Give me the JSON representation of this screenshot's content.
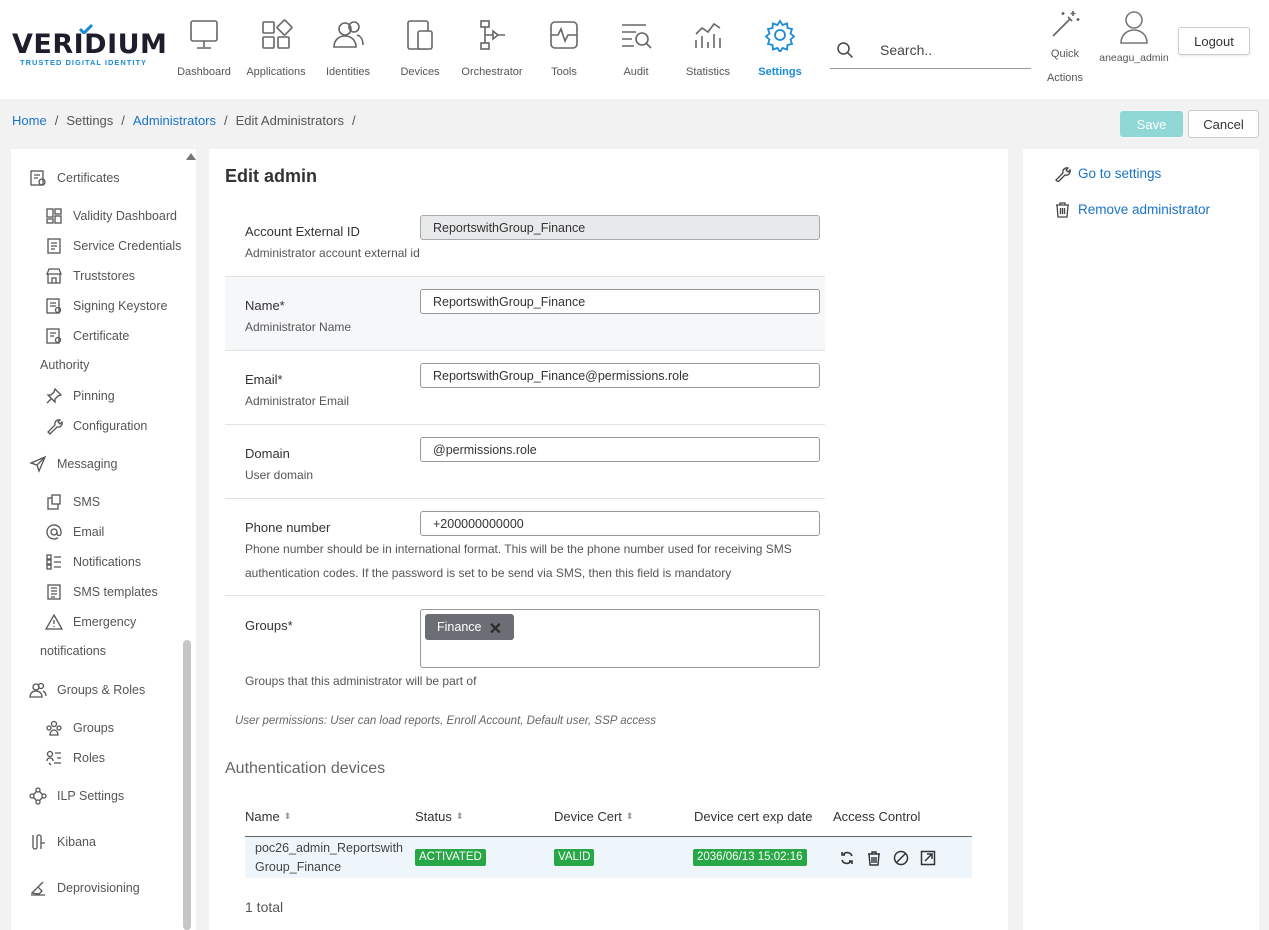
{
  "brand": {
    "name": "VERIDIUM",
    "tagline": "TRUSTED DIGITAL IDENTITY",
    "accent": "#1a8bd6"
  },
  "nav": [
    {
      "label": "Dashboard",
      "icon": "monitor-icon",
      "active": false
    },
    {
      "label": "Applications",
      "icon": "apps-icon",
      "active": false
    },
    {
      "label": "Identities",
      "icon": "identities-icon",
      "active": false
    },
    {
      "label": "Devices",
      "icon": "devices-icon",
      "active": false
    },
    {
      "label": "Orchestrator",
      "icon": "orchestrator-icon",
      "active": false
    },
    {
      "label": "Tools",
      "icon": "tools-icon",
      "active": false
    },
    {
      "label": "Audit",
      "icon": "audit-icon",
      "active": false
    },
    {
      "label": "Statistics",
      "icon": "statistics-icon",
      "active": false
    },
    {
      "label": "Settings",
      "icon": "gear-icon",
      "active": true
    }
  ],
  "search": {
    "placeholder": "Search.."
  },
  "quick_actions": {
    "label_line1": "Quick",
    "label_line2": "Actions"
  },
  "user": {
    "name": "aneagu_admin"
  },
  "logout_label": "Logout",
  "breadcrumb": {
    "home": "Home",
    "settings": "Settings",
    "administrators": "Administrators",
    "current": "Edit Administrators",
    "sep": "/"
  },
  "actions": {
    "save": "Save",
    "cancel": "Cancel"
  },
  "sidebar": {
    "certificates": "Certificates",
    "validity_dashboard": "Validity Dashboard",
    "service_credentials": "Service Credentials",
    "truststores": "Truststores",
    "signing_keystore": "Signing Keystore",
    "certificate": "Certificate",
    "authority": "Authority",
    "pinning": "Pinning",
    "configuration": "Configuration",
    "messaging": "Messaging",
    "sms": "SMS",
    "email": "Email",
    "notifications": "Notifications",
    "sms_templates": "SMS templates",
    "emergency": "Emergency",
    "emergency_notifications": "notifications",
    "groups_roles": "Groups & Roles",
    "groups": "Groups",
    "roles": "Roles",
    "ilp_settings": "ILP Settings",
    "kibana": "Kibana",
    "deprovisioning": "Deprovisioning"
  },
  "form": {
    "title": "Edit admin",
    "external_id": {
      "label": "Account External ID",
      "help": "Administrator account external id",
      "value": "ReportswithGroup_Finance"
    },
    "name": {
      "label": "Name*",
      "help": "Administrator Name",
      "value": "ReportswithGroup_Finance"
    },
    "email": {
      "label": "Email*",
      "help": "Administrator Email",
      "value": "ReportswithGroup_Finance@permissions.role"
    },
    "domain": {
      "label": "Domain",
      "help": "User domain",
      "value": "@permissions.role"
    },
    "phone": {
      "label": "Phone number",
      "help_line1": "Phone number should be in international format. This will be the phone number used for receiving SMS",
      "help_line2": "authentication codes. If the password is set to be send via SMS, then this field is mandatory",
      "value": "+200000000000"
    },
    "groups": {
      "label": "Groups*",
      "help": "Groups that this administrator will be part of",
      "chips": [
        "Finance"
      ]
    },
    "permissions": "User permissions: User can load reports, Enroll Account, Default user, SSP access"
  },
  "devices": {
    "title": "Authentication devices",
    "columns": {
      "name": "Name",
      "status": "Status",
      "cert": "Device Cert",
      "exp": "Device cert exp date",
      "access": "Access Control"
    },
    "rows": [
      {
        "name_line1": "poc26_admin_Reportswith",
        "name_line2": "Group_Finance",
        "status": "ACTIVATED",
        "cert": "VALID",
        "exp": "2036/06/13 15:02:16"
      }
    ],
    "total": "1 total"
  },
  "right_panel": {
    "go_settings": "Go to settings",
    "remove_admin": "Remove administrator"
  }
}
